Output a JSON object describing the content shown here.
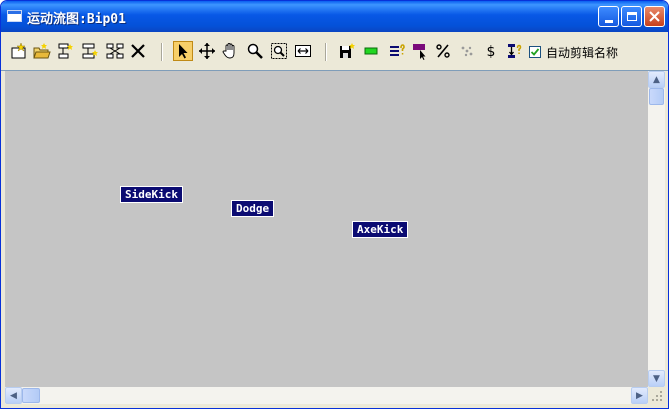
{
  "window": {
    "title": "运动流图:Bip01",
    "icon": "window-icon",
    "controls": [
      "minimize",
      "maximize",
      "close"
    ]
  },
  "toolbar": {
    "groups": [
      [
        "new-script-icon",
        "open-file-icon",
        "insert-transition-icon",
        "insert-clip-icon",
        "create-multiple-icon",
        "delete-icon"
      ],
      [
        "select-arrow-icon",
        "move-icon",
        "pan-hand-icon",
        "zoom-icon",
        "zoom-region-icon",
        "zoom-extents-icon"
      ],
      [
        "save-file-icon",
        "green-bar-icon",
        "clip-properties-icon",
        "select-clip-icon",
        "percent-icon",
        "random-icon",
        "dollar-icon",
        "sort-icon"
      ]
    ],
    "active_tool": "select-arrow-icon",
    "auto_clip_names": {
      "label": "自动剪辑名称",
      "checked": true
    }
  },
  "canvas": {
    "background": "#c5c5c5",
    "nodes": [
      {
        "label": "SideKick"
      },
      {
        "label": "Dodge"
      },
      {
        "label": "AxeKick"
      }
    ]
  },
  "colors": {
    "title_bar": "#0858e6",
    "node_fill": "#0b0b72",
    "node_text": "#ffffff"
  }
}
